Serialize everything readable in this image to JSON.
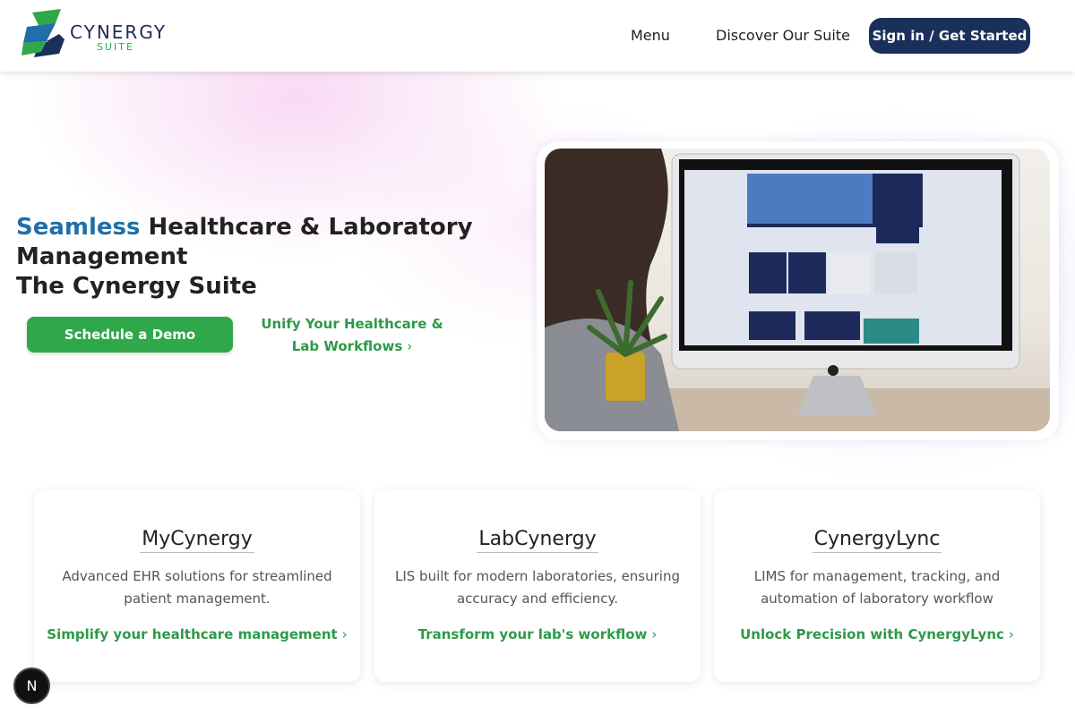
{
  "brand": {
    "name": "CYNERGY",
    "sub": "SUITE",
    "colors": {
      "navy": "#1a2f5a",
      "green": "#2ea84a",
      "blue_accent": "#1f6fa8"
    }
  },
  "nav": {
    "menu_label": "Menu",
    "discover_label": "Discover Our Suite",
    "signin_label": "Sign in / Get Started"
  },
  "hero": {
    "title_accent": "Seamless",
    "title_rest_line1": " Healthcare & Laboratory",
    "title_line2": "Management",
    "title_line3": "The Cynergy Suite",
    "demo_button": "Schedule a Demo",
    "unify_link": "Unify Your Healthcare & Lab Workflows",
    "image_icon": "desktop-computer-photo"
  },
  "cards": [
    {
      "title": "MyCynergy",
      "description": "Advanced EHR solutions for streamlined patient management.",
      "link": "Simplify your healthcare management"
    },
    {
      "title": "LabCynergy",
      "description": "LIS built for modern laboratories, ensuring accuracy and efficiency.",
      "link": "Transform your lab's workflow"
    },
    {
      "title": "CynergyLync",
      "description": "LIMS for management, tracking, and automation of laboratory workflow",
      "link": "Unlock Precision with CynergyLync"
    }
  ],
  "floating_button": {
    "label": "N"
  },
  "icons": {
    "chevron": "chevron-right-icon"
  }
}
